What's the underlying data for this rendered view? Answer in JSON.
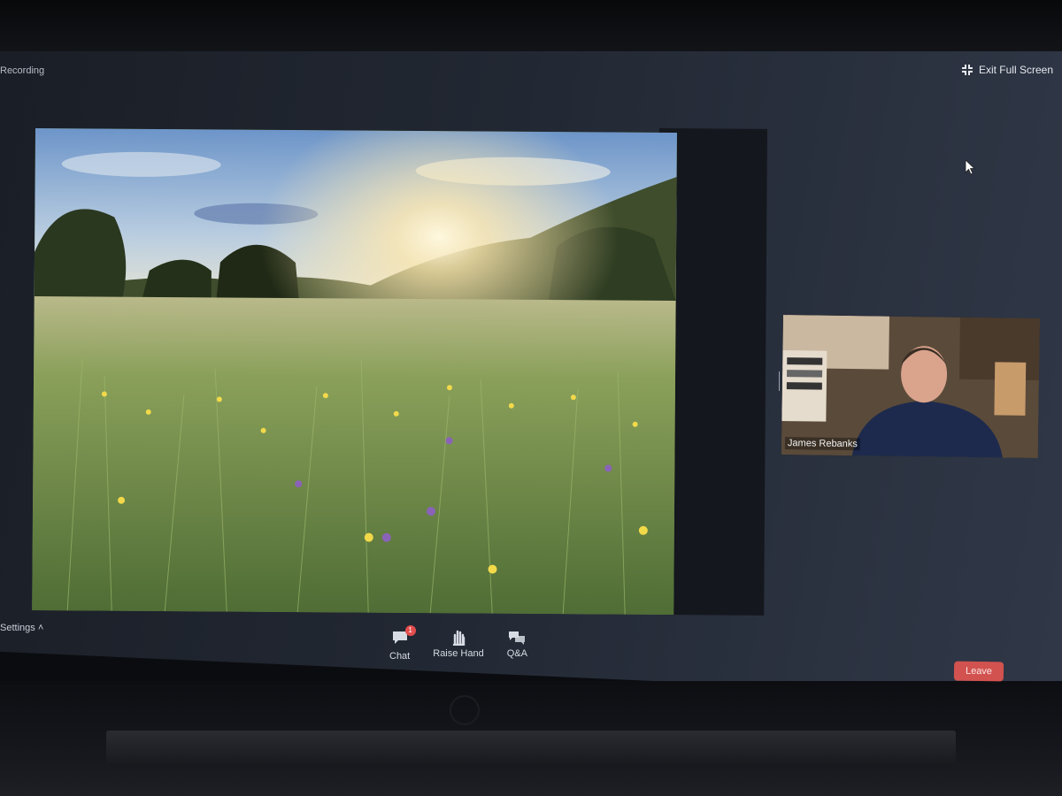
{
  "top_bar": {
    "recording_label": "Recording",
    "exit_fullscreen_label": "Exit Full Screen"
  },
  "speaker": {
    "name": "James Rebanks"
  },
  "toolbar": {
    "settings_label": "Settings",
    "chat_label": "Chat",
    "chat_badge": "1",
    "raise_hand_label": "Raise Hand",
    "qa_label": "Q&A",
    "leave_label": "Leave"
  },
  "colors": {
    "leave_button": "#d2524f",
    "badge": "#e34d4d"
  }
}
